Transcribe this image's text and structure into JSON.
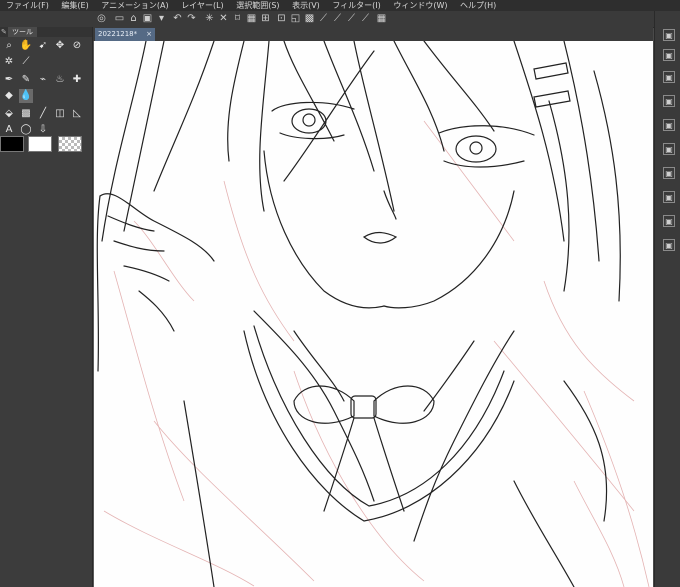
{
  "menu": [
    "ファイル(F)",
    "編集(E)",
    "アニメーション(A)",
    "レイヤー(L)",
    "選択範囲(S)",
    "表示(V)",
    "フィルター(I)",
    "ウィンドウ(W)",
    "ヘルプ(H)"
  ],
  "tool_panel": {
    "tab_label": "ツール"
  },
  "document": {
    "tab_title": "20221218*",
    "close_glyph": "×"
  },
  "colors": {
    "main_color": "#000000",
    "sub_color": "#ffffff",
    "accent_tab": "#556a85"
  }
}
